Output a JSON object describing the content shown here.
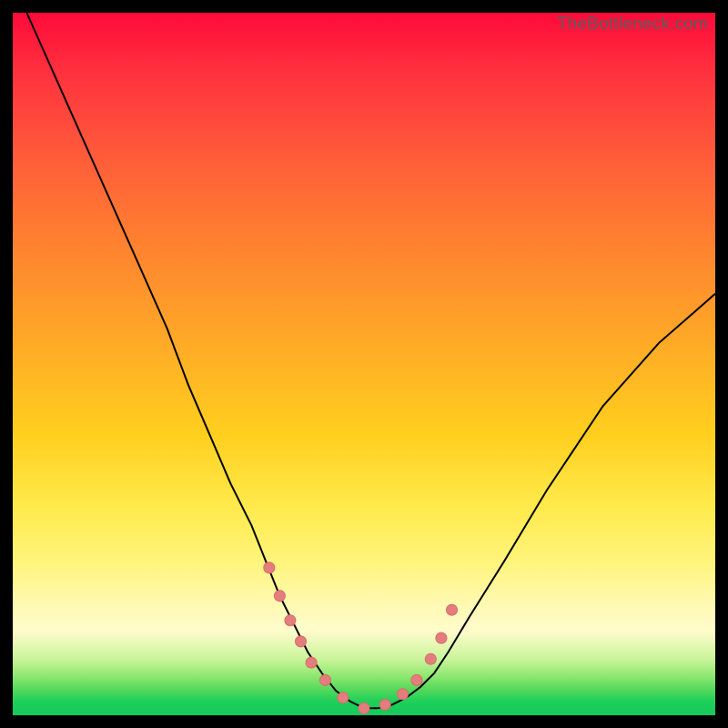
{
  "watermark": "TheBottleneck.com",
  "chart_data": {
    "type": "line",
    "title": "",
    "xlabel": "",
    "ylabel": "",
    "xlim": [
      0,
      100
    ],
    "ylim": [
      0,
      100
    ],
    "series": [
      {
        "name": "bottleneck-curve",
        "x": [
          2,
          6,
          10,
          14,
          18,
          22,
          25,
          28,
          31,
          34,
          36,
          38,
          40,
          42,
          44,
          46,
          48,
          50,
          52,
          54,
          56,
          58,
          60,
          62,
          65,
          70,
          76,
          84,
          92,
          100
        ],
        "y": [
          100,
          91,
          82,
          73,
          64,
          55,
          47,
          40,
          33,
          27,
          22,
          17,
          13,
          9,
          6,
          3.5,
          2,
          1,
          1,
          1.5,
          2.5,
          4,
          6,
          9,
          14,
          22,
          32,
          44,
          53,
          60
        ]
      }
    ],
    "markers": {
      "name": "highlight-points",
      "x": [
        36.5,
        38,
        39.5,
        41,
        42.5,
        44.5,
        47,
        50,
        53,
        55.5,
        57.5,
        59.5,
        61,
        62.5
      ],
      "y": [
        21,
        17,
        13.5,
        10.5,
        7.5,
        5,
        2.5,
        1,
        1.5,
        3,
        5,
        8,
        11,
        15
      ]
    },
    "background_gradient": {
      "top": "#ff0a3a",
      "mid": "#ffe94a",
      "bottom": "#14c95c"
    }
  }
}
